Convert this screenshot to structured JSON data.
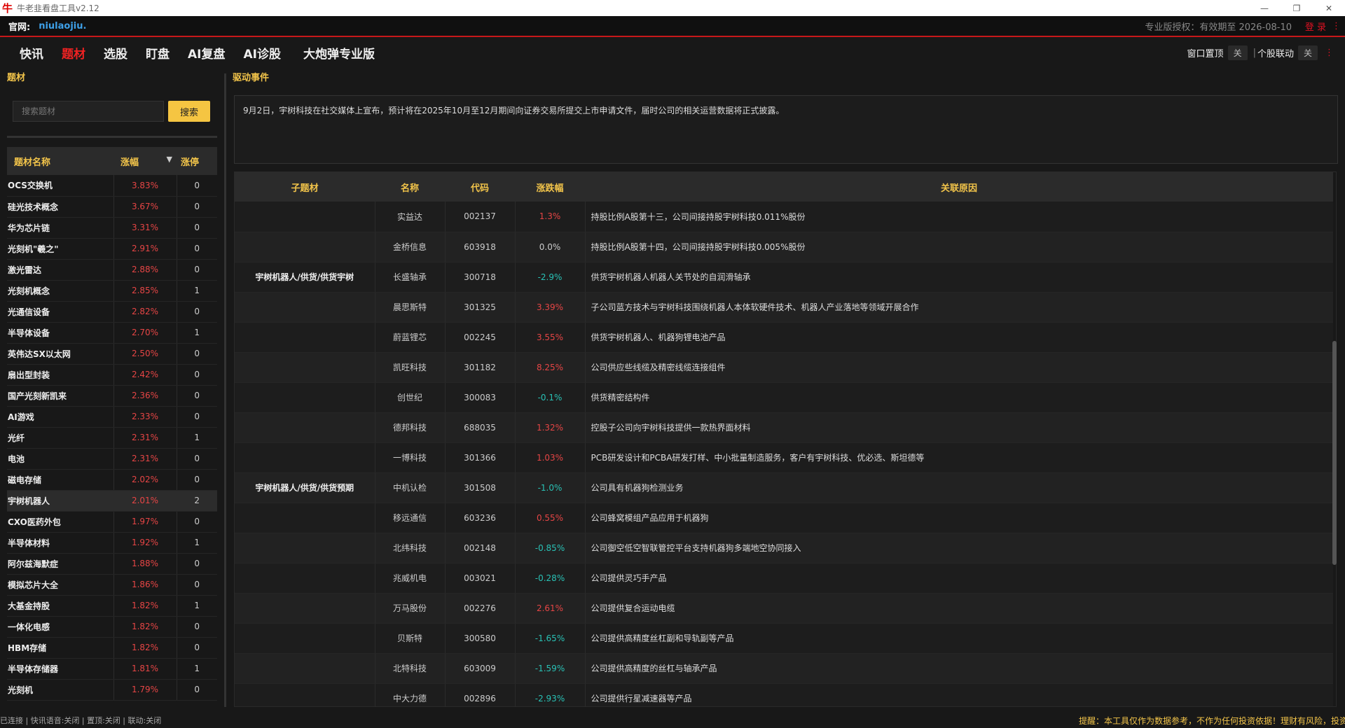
{
  "window": {
    "title": "牛老韭看盘工具v2.12",
    "icon": "牛"
  },
  "site": {
    "label": "官网:",
    "url": "niulaojiu.",
    "auth": "专业版授权：有效期至 2026-08-10",
    "login": "登 录"
  },
  "nav": {
    "items": [
      {
        "label": "快讯",
        "active": false
      },
      {
        "label": "题材",
        "active": true
      },
      {
        "label": "选股",
        "active": false
      },
      {
        "label": "盯盘",
        "active": false
      },
      {
        "label": "AI复盘",
        "active": false
      },
      {
        "label": "AI诊股",
        "active": false
      },
      {
        "label": "大炮弹专业版",
        "active": false
      }
    ],
    "pin_label": "窗口置顶",
    "pin_value": "关",
    "link_label": "个股联动",
    "link_value": "关"
  },
  "left": {
    "section_title": "题材",
    "search_placeholder": "搜索题材",
    "search_button": "搜索",
    "headers": {
      "name": "题材名称",
      "pct": "涨幅",
      "sort": "▼",
      "limit": "涨停"
    },
    "topics": [
      {
        "name": "OCS交换机",
        "pct": "3.83%",
        "limit": "0"
      },
      {
        "name": "硅光技术概念",
        "pct": "3.67%",
        "limit": "0"
      },
      {
        "name": "华为芯片链",
        "pct": "3.31%",
        "limit": "0"
      },
      {
        "name": "光刻机\"羲之\"",
        "pct": "2.91%",
        "limit": "0"
      },
      {
        "name": "激光雷达",
        "pct": "2.88%",
        "limit": "0"
      },
      {
        "name": "光刻机概念",
        "pct": "2.85%",
        "limit": "1"
      },
      {
        "name": "光通信设备",
        "pct": "2.82%",
        "limit": "0"
      },
      {
        "name": "半导体设备",
        "pct": "2.70%",
        "limit": "1"
      },
      {
        "name": "英伟达SX以太网",
        "pct": "2.50%",
        "limit": "0"
      },
      {
        "name": "扇出型封装",
        "pct": "2.42%",
        "limit": "0"
      },
      {
        "name": "国产光刻新凯来",
        "pct": "2.36%",
        "limit": "0"
      },
      {
        "name": "AI游戏",
        "pct": "2.33%",
        "limit": "0"
      },
      {
        "name": "光纤",
        "pct": "2.31%",
        "limit": "1"
      },
      {
        "name": "电池",
        "pct": "2.31%",
        "limit": "0"
      },
      {
        "name": "磁电存储",
        "pct": "2.02%",
        "limit": "0"
      },
      {
        "name": "宇树机器人",
        "pct": "2.01%",
        "limit": "2",
        "selected": true
      },
      {
        "name": "CXO医药外包",
        "pct": "1.97%",
        "limit": "0"
      },
      {
        "name": "半导体材料",
        "pct": "1.92%",
        "limit": "1"
      },
      {
        "name": "阿尔兹海默症",
        "pct": "1.88%",
        "limit": "0"
      },
      {
        "name": "模拟芯片大全",
        "pct": "1.86%",
        "limit": "0"
      },
      {
        "name": "大基金持股",
        "pct": "1.82%",
        "limit": "1"
      },
      {
        "name": "一体化电感",
        "pct": "1.82%",
        "limit": "0"
      },
      {
        "name": "HBM存储",
        "pct": "1.82%",
        "limit": "0"
      },
      {
        "name": "半导体存储器",
        "pct": "1.81%",
        "limit": "1"
      },
      {
        "name": "光刻机",
        "pct": "1.79%",
        "limit": "0"
      }
    ]
  },
  "right": {
    "section_title": "驱动事件",
    "event_text": "9月2日，宇树科技在社交媒体上宣布，预计将在2025年10月至12月期间向证券交易所提交上市申请文件，届时公司的相关运营数据将正式披露。",
    "headers": {
      "sub": "子题材",
      "name": "名称",
      "code": "代码",
      "pct": "涨跌幅",
      "reason": "关联原因"
    },
    "rows": [
      {
        "sub": "",
        "name": "实益达",
        "code": "002137",
        "pct": "1.3%",
        "dir": "up",
        "reason": "持股比例A股第十三，公司间接持股宇树科技0.011%股份"
      },
      {
        "sub": "",
        "name": "金桥信息",
        "code": "603918",
        "pct": "0.0%",
        "dir": "flat",
        "reason": "持股比例A股第十四，公司间接持股宇树科技0.005%股份"
      },
      {
        "sub": "宇树机器人/供货/供货宇树",
        "name": "长盛轴承",
        "code": "300718",
        "pct": "-2.9%",
        "dir": "down",
        "reason": "供货宇树机器人机器人关节处的自润滑轴承"
      },
      {
        "sub": "",
        "name": "晨思斯特",
        "code": "301325",
        "pct": "3.39%",
        "dir": "up",
        "reason": "子公司蓝方技术与宇树科技围绕机器人本体软硬件技术、机器人产业落地等领域开展合作"
      },
      {
        "sub": "",
        "name": "蔚蓝锂芯",
        "code": "002245",
        "pct": "3.55%",
        "dir": "up",
        "reason": "供货宇树机器人、机器狗锂电池产品"
      },
      {
        "sub": "",
        "name": "凯旺科技",
        "code": "301182",
        "pct": "8.25%",
        "dir": "up",
        "reason": "公司供应些线缆及精密线缆连接组件"
      },
      {
        "sub": "",
        "name": "创世纪",
        "code": "300083",
        "pct": "-0.1%",
        "dir": "down",
        "reason": "供货精密结构件"
      },
      {
        "sub": "",
        "name": "德邦科技",
        "code": "688035",
        "pct": "1.32%",
        "dir": "up",
        "reason": "控股子公司向宇树科技提供一款热界面材料"
      },
      {
        "sub": "",
        "name": "一博科技",
        "code": "301366",
        "pct": "1.03%",
        "dir": "up",
        "reason": "PCB研发设计和PCBA研发打样、中小批量制造服务，客户有宇树科技、优必选、斯坦德等"
      },
      {
        "sub": "宇树机器人/供货/供货预期",
        "name": "中机认检",
        "code": "301508",
        "pct": "-1.0%",
        "dir": "down",
        "reason": "公司具有机器狗检测业务"
      },
      {
        "sub": "",
        "name": "移远通信",
        "code": "603236",
        "pct": "0.55%",
        "dir": "up",
        "reason": "公司蜂窝模组产品应用于机器狗"
      },
      {
        "sub": "",
        "name": "北纬科技",
        "code": "002148",
        "pct": "-0.85%",
        "dir": "down",
        "reason": "公司御空低空智联管控平台支持机器狗多端地空协同接入"
      },
      {
        "sub": "",
        "name": "兆威机电",
        "code": "003021",
        "pct": "-0.28%",
        "dir": "down",
        "reason": "公司提供灵巧手产品"
      },
      {
        "sub": "",
        "name": "万马股份",
        "code": "002276",
        "pct": "2.61%",
        "dir": "up",
        "reason": "公司提供复合运动电缆"
      },
      {
        "sub": "",
        "name": "贝斯特",
        "code": "300580",
        "pct": "-1.65%",
        "dir": "down",
        "reason": "公司提供高精度丝杠副和导轨副等产品"
      },
      {
        "sub": "",
        "name": "北特科技",
        "code": "603009",
        "pct": "-1.59%",
        "dir": "down",
        "reason": "公司提供高精度的丝杠与轴承产品"
      },
      {
        "sub": "",
        "name": "中大力德",
        "code": "002896",
        "pct": "-2.93%",
        "dir": "down",
        "reason": "公司提供行星减速器等产品"
      }
    ]
  },
  "status": {
    "left": "已连接 | 快讯语音:关闭 | 置顶:关闭 | 联动:关闭",
    "warning": "提醒：本工具仅作为数据参考，不作为任何投资依据！理财有风险，投资"
  },
  "colors": {
    "accent": "#f2c44a",
    "up": "#e64545",
    "down": "#29c1b5",
    "brand_red": "#c8181a"
  }
}
